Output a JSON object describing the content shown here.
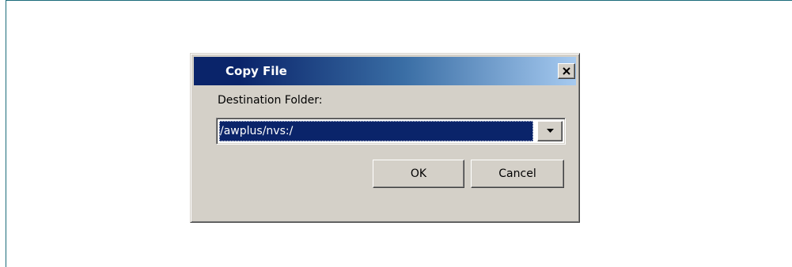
{
  "dialog": {
    "title": "Copy File",
    "close_glyph": "✕",
    "destination_label": "Destination Folder:",
    "destination_value": "/awplus/nvs:/",
    "ok_label": "OK",
    "cancel_label": "Cancel"
  },
  "icons": {
    "close": "close-icon",
    "dropdown": "chevron-down-icon"
  },
  "colors": {
    "titlebar_start": "#0a246a",
    "titlebar_end": "#a6caf0",
    "dialog_face": "#d4d0c8",
    "selection": "#0a246a",
    "frame_line": "#1b6b7a"
  }
}
